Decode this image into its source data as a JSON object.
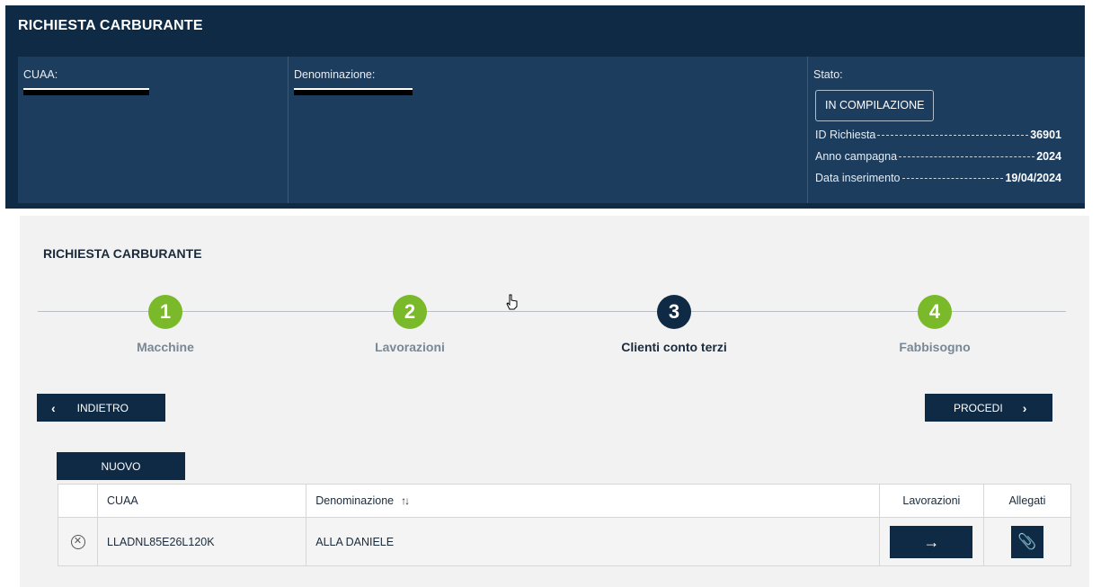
{
  "header": {
    "title": "RICHIESTA CARBURANTE",
    "cuaa_label": "CUAA:",
    "denominazione_label": "Denominazione:",
    "stato_label": "Stato:",
    "stato_value": "IN COMPILAZIONE",
    "details": [
      {
        "key": "ID Richiesta",
        "value": "36901"
      },
      {
        "key": "Anno campagna",
        "value": "2024"
      },
      {
        "key": "Data inserimento",
        "value": "19/04/2024"
      }
    ]
  },
  "main": {
    "title": "RICHIESTA CARBURANTE",
    "steps": [
      {
        "number": "1",
        "label": "Macchine",
        "state": "done"
      },
      {
        "number": "2",
        "label": "Lavorazioni",
        "state": "done"
      },
      {
        "number": "3",
        "label": "Clienti conto terzi",
        "state": "active"
      },
      {
        "number": "4",
        "label": "Fabbisogno",
        "state": "done"
      }
    ],
    "back_label": "INDIETRO",
    "next_label": "PROCEDI",
    "new_label": "NUOVO"
  },
  "table": {
    "headers": {
      "cuaa": "CUAA",
      "denominazione": "Denominazione",
      "sort_icon": "↑↓",
      "lavorazioni": "Lavorazioni",
      "allegati": "Allegati"
    },
    "rows": [
      {
        "cuaa": "LLADNL85E26L120K",
        "denominazione": "ALLA DANIELE"
      }
    ]
  },
  "icons": {
    "back": "chevron-left-icon",
    "next": "chevron-right-icon",
    "delete": "close-circle-icon",
    "lavorazioni": "arrow-right-icon",
    "allegati": "paperclip-icon"
  },
  "colors": {
    "header_bg": "#0f2a44",
    "panel_bg": "#1c3d5e",
    "step_done": "#7ab929",
    "step_active": "#0f2a44",
    "button_bg": "#0f2a44"
  }
}
